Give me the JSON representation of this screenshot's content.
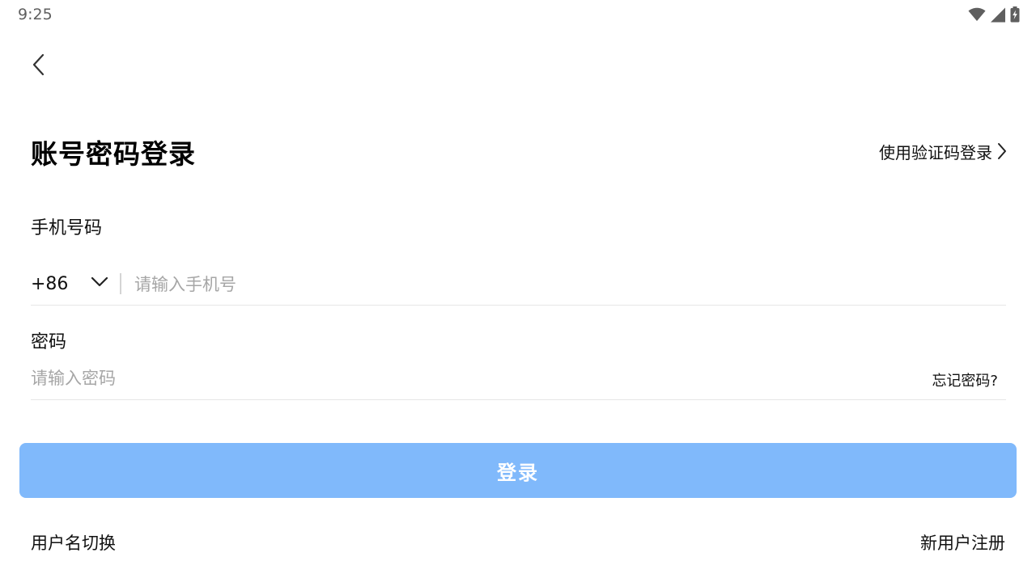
{
  "status_bar": {
    "time": "9:25",
    "icons": [
      "wifi-icon",
      "cellular-signal-icon",
      "battery-charging-icon"
    ]
  },
  "header": {
    "back_icon": "chevron-left-icon"
  },
  "title": "账号密码登录",
  "switch_login": {
    "label": "使用验证码登录",
    "icon": "chevron-right-icon"
  },
  "phone": {
    "label": "手机号码",
    "country_code": "+86",
    "placeholder": "请输入手机号",
    "value": ""
  },
  "password": {
    "label": "密码",
    "placeholder": "请输入密码",
    "value": "",
    "forgot_label": "忘记密码?"
  },
  "login_button": {
    "label": "登录"
  },
  "bottom": {
    "username_switch": "用户名切换",
    "register": "新用户注册"
  },
  "colors": {
    "primary_disabled": "#80b9fb",
    "text": "#111111",
    "placeholder": "#a6a6a6",
    "divider": "#e6e6e6"
  }
}
